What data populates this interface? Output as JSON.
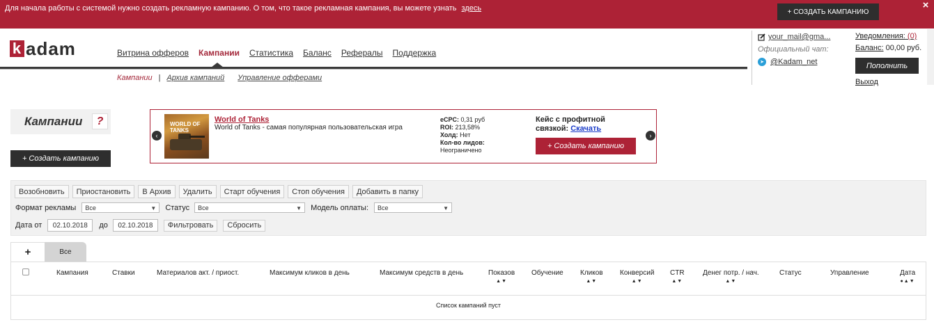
{
  "banner": {
    "text": "Для начала работы с системой нужно создать рекламную кампанию. О том, что такое рекламная кампания, вы можете узнать",
    "link": "здесь",
    "button": "+ СОЗДАТЬ КАМПАНИЮ",
    "close": "×"
  },
  "logo": {
    "k": "k",
    "rest": "adam"
  },
  "nav": {
    "items": [
      "Витрина офферов",
      "Кампании",
      "Статистика",
      "Баланс",
      "Рефералы",
      "Поддержка"
    ],
    "active_index": 1
  },
  "subnav": {
    "items": [
      "Кампании",
      "Архив кампаний",
      "Управление офферами"
    ],
    "sep": "|"
  },
  "account": {
    "email": "your_mail@gma...",
    "chat_label": "Официальный чат:",
    "telegram": "@Kadam_net",
    "notifications_label": "Уведомления:",
    "notifications_count": "(0)",
    "balance_label": "Баланс:",
    "balance_value": "00,00 руб.",
    "topup": "Пополнить",
    "logout": "Выход"
  },
  "page": {
    "title": "Кампании",
    "help": "?",
    "create_button": "+ Создать кампанию"
  },
  "offer": {
    "title": "World of Tanks",
    "description": "World of Tanks - самая популярная пользовательская игра",
    "thumb_text": "WORLD OF TANKS",
    "stats": [
      {
        "label": "eCPC:",
        "value": "0,31 руб"
      },
      {
        "label": "ROI:",
        "value": "213,58%"
      },
      {
        "label": "Холд:",
        "value": "Нет"
      },
      {
        "label": "Кол-во лидов:",
        "value": ""
      }
    ],
    "leads_value": "Неограничено",
    "case_line1": "Кейс с профитной",
    "case_line2": "связкой:",
    "case_link": "Скачать",
    "create_button": "+ Создать кампанию",
    "prev": "‹",
    "next": "›"
  },
  "filters": {
    "buttons": [
      "Возобновить",
      "Приостановить",
      "В Архив",
      "Удалить",
      "Старт обучения",
      "Стоп обучения",
      "Добавить в папку"
    ],
    "format_label": "Формат рекламы",
    "format_value": "Все",
    "status_label": "Статус",
    "status_value": "Все",
    "payment_label": "Модель оплаты:",
    "payment_value": "Все",
    "date_from_label": "Дата от",
    "date_from": "02.10.2018",
    "date_to_label": "до",
    "date_to": "02.10.2018",
    "filter_button": "Фильтровать",
    "reset_button": "Сбросить"
  },
  "tabs": {
    "plus": "+",
    "all": "Все"
  },
  "table": {
    "columns": [
      "Кампания",
      "Ставки",
      "Материалов акт. / приост.",
      "Максимум кликов в день",
      "Максимум средств в день",
      "Показов",
      "Обучение",
      "Кликов",
      "Конверсий",
      "CTR",
      "Денег потр. / нач.",
      "Статус",
      "Управление",
      "Дата"
    ],
    "empty": "Список кампаний пуст"
  },
  "colors": {
    "accent": "#ad2236",
    "dark": "#2e2e2e"
  }
}
